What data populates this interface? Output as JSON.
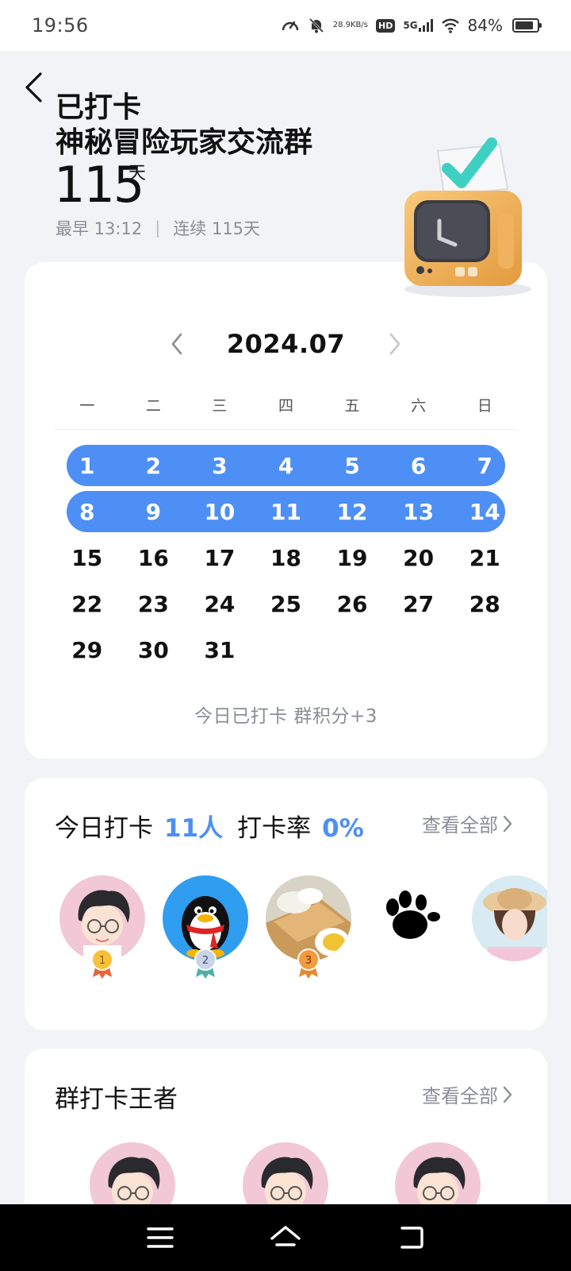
{
  "status_bar": {
    "time": "19:56",
    "net_speed_value": "28.9",
    "net_speed_unit": "KB/s",
    "hd_label": "HD",
    "network_label": "5G",
    "battery_text": "84%",
    "battery_level": 0.84
  },
  "header": {
    "title": "已打卡",
    "group_name": "神秘冒险玩家交流群",
    "days_count": "115",
    "days_unit": "天",
    "earliest": "最早 13:12",
    "separator": "|",
    "streak": "连续 115天"
  },
  "calendar": {
    "month": "2024.07",
    "weekdays": [
      "一",
      "二",
      "三",
      "四",
      "五",
      "六",
      "日"
    ],
    "weeks": [
      [
        "1",
        "2",
        "3",
        "4",
        "5",
        "6",
        "7"
      ],
      [
        "8",
        "9",
        "10",
        "11",
        "12",
        "13",
        "14"
      ],
      [
        "15",
        "16",
        "17",
        "18",
        "19",
        "20",
        "21"
      ],
      [
        "22",
        "23",
        "24",
        "25",
        "26",
        "27",
        "28"
      ],
      [
        "29",
        "30",
        "31",
        "",
        "",
        "",
        ""
      ]
    ],
    "checked_weeks": [
      0,
      1
    ],
    "today_note": "今日已打卡  群积分+3",
    "highlight_color": "#4d8ff5"
  },
  "today": {
    "label": "今日打卡",
    "count": "11人",
    "rate_label": "打卡率",
    "rate": "0%",
    "view_all": "查看全部",
    "ranks": [
      "1",
      "2",
      "3"
    ]
  },
  "king": {
    "title": "群打卡王者",
    "view_all": "查看全部"
  },
  "colors": {
    "accent": "#4d8ff5",
    "muted": "#8a8e96",
    "background": "#f2f3f7"
  }
}
